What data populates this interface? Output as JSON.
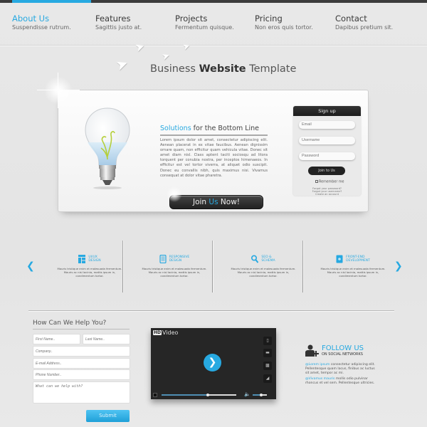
{
  "nav": {
    "items": [
      {
        "title": "About Us",
        "subtitle": "Suspendisse rutrum.",
        "active": true
      },
      {
        "title": "Features",
        "subtitle": "Sagittis justo at.",
        "active": false
      },
      {
        "title": "Projects",
        "subtitle": "Fermentum quisque.",
        "active": false
      },
      {
        "title": "Pricing",
        "subtitle": "Non eros quis tortor.",
        "active": false
      },
      {
        "title": "Contact",
        "subtitle": "Dapibus pretium sit.",
        "active": false
      }
    ]
  },
  "header": {
    "title_prefix": "Business ",
    "title_bold": "Website",
    "title_suffix": " Template"
  },
  "hero": {
    "heading_accent": "Solutions",
    "heading_rest": " for the Bottom Line",
    "body": "Lorem ipsum dolor sit amet, consectetur adipiscing elit. Aenean placerat in ex vitae faucibus. Aenean dignissim ornare quam, non efficitur quam vehicula vitae. Donec sit amet diam nisl. Class aptent taciti sociosqu ad litora torquent per conubia nostra, per inceptos himenaeos. In efficitur est vel tortor viverra, at aliquet odio suscipit. Donec eu convallis nibh, quis maximus nisi. Vivamus consequat at dolor vitae pharetra.",
    "cta": {
      "prefix": "Join ",
      "accent": "Us",
      "suffix": " Now!"
    }
  },
  "signup": {
    "title": "Sign up",
    "email_placeholder": "Email",
    "username_placeholder": "Username",
    "password_placeholder": "Password",
    "button": "Join to Us",
    "remember": "Remember me",
    "links": [
      "Forgot your password?",
      "Forgot your username?",
      "Create an account"
    ]
  },
  "features": {
    "prev_icon": "chevron-left-icon",
    "next_icon": "chevron-right-icon",
    "items": [
      {
        "icon": "layout-icon",
        "label_line1": "UI/UX",
        "label_line2": "DESIGN",
        "text": "Mauris tristique enim et malesuada fermentum. Mauris ac nisl lacinia, mattis ipsum in, condimentum tortor."
      },
      {
        "icon": "mobile-icon",
        "label_line1": "RESPONSIVE",
        "label_line2": "DESIGN",
        "text": "Mauris tristique enim et malesuada fermentum. Mauris ac nisl lacinia, mattis ipsum in, condimentum tortor."
      },
      {
        "icon": "search-icon",
        "label_line1": "SEO &",
        "label_line2": "SCHEMA",
        "text": "Mauris tristique enim et malesuada fermentum. Mauris ac nisl lacinia, mattis ipsum in, condimentum tortor."
      },
      {
        "icon": "document-icon",
        "label_line1": "FRONT-END",
        "label_line2": "DEVELOPMENT",
        "text": "Mauris tristique enim et malesuada fermentum. Mauris ac nisl lacinia, mattis ipsum in, condimentum tortor."
      }
    ]
  },
  "help_form": {
    "title": "How Can We Help You?",
    "first_name_placeholder": "First Name..",
    "last_name_placeholder": "Last Name..",
    "company_placeholder": "Company..",
    "email_placeholder": "E-mail Address..",
    "phone_placeholder": "Phone Number..",
    "message_placeholder": "What can we help with?",
    "submit": "Submit"
  },
  "video": {
    "badge": "HD",
    "title": "Video",
    "progress": 0.62,
    "volume": 0.6,
    "side_buttons": [
      "phone-icon",
      "widescreen-icon",
      "quality-icon",
      "signal-icon"
    ]
  },
  "social": {
    "title": "FOLLOW US",
    "subtitle": "ON SOCIAL NETWORKS",
    "posts": [
      {
        "handle": "@Lorem ipsum",
        "text": " consectetur adipiscing elit. Pellentesque quam lacus, finibus ac luctus sit amet, tempor ac mi."
      },
      {
        "handle": "@Vivamus mauris",
        "text": " mollis odio pulvinar rhoncus et vel sem. Pellentesque ultricies."
      }
    ]
  },
  "colors": {
    "accent": "#27a9e1",
    "dark": "#262626",
    "background": "#e6e6e6"
  }
}
